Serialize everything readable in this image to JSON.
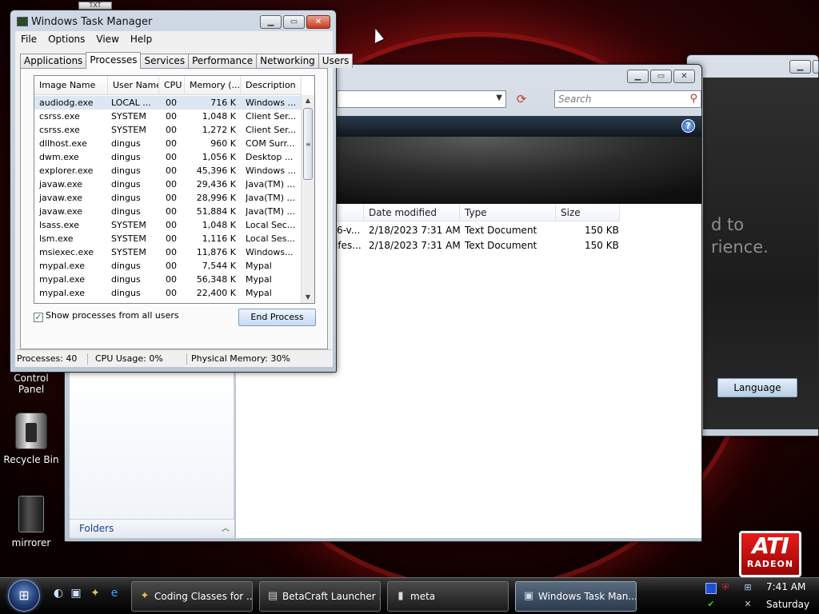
{
  "desktop": {
    "icons": [
      {
        "label": "Control Panel",
        "icon": "control-panel-icon"
      },
      {
        "label": "Recycle Bin",
        "icon": "recycle-bin-icon"
      },
      {
        "label": "mirrorer",
        "icon": "file-icon"
      }
    ],
    "txt_tag": "TXT",
    "ati_logo": {
      "main": "ATI",
      "sub": "RADEON"
    }
  },
  "bg_window": {
    "text_line1": "d to",
    "text_line2": "rience.",
    "language_button": "Language"
  },
  "explorer": {
    "search_placeholder": "Search",
    "columns": [
      "Date modified",
      "Type",
      "Size"
    ],
    "files": [
      {
        "name_fragment": "6-v...",
        "date": "2/18/2023 7:31 AM",
        "type": "Text Document",
        "size": "150 KB"
      },
      {
        "name_fragment": "ifes...",
        "date": "2/18/2023 7:31 AM",
        "type": "Text Document",
        "size": "150 KB"
      }
    ],
    "folders_label": "Folders"
  },
  "taskmgr": {
    "title": "Windows Task Manager",
    "menu": [
      "File",
      "Options",
      "View",
      "Help"
    ],
    "tabs": [
      "Applications",
      "Processes",
      "Services",
      "Performance",
      "Networking",
      "Users"
    ],
    "active_tab": "Processes",
    "columns": [
      "Image Name",
      "User Name",
      "CPU",
      "Memory (...",
      "Description"
    ],
    "processes": [
      {
        "image": "audiodg.exe",
        "user": "LOCAL ...",
        "cpu": "00",
        "mem": "716 K",
        "desc": "Windows ..."
      },
      {
        "image": "csrss.exe",
        "user": "SYSTEM",
        "cpu": "00",
        "mem": "1,048 K",
        "desc": "Client Ser..."
      },
      {
        "image": "csrss.exe",
        "user": "SYSTEM",
        "cpu": "00",
        "mem": "1,272 K",
        "desc": "Client Ser..."
      },
      {
        "image": "dllhost.exe",
        "user": "dingus",
        "cpu": "00",
        "mem": "960 K",
        "desc": "COM Surr..."
      },
      {
        "image": "dwm.exe",
        "user": "dingus",
        "cpu": "00",
        "mem": "1,056 K",
        "desc": "Desktop ..."
      },
      {
        "image": "explorer.exe",
        "user": "dingus",
        "cpu": "00",
        "mem": "45,396 K",
        "desc": "Windows ..."
      },
      {
        "image": "javaw.exe",
        "user": "dingus",
        "cpu": "00",
        "mem": "29,436 K",
        "desc": "Java(TM) ..."
      },
      {
        "image": "javaw.exe",
        "user": "dingus",
        "cpu": "00",
        "mem": "28,996 K",
        "desc": "Java(TM) ..."
      },
      {
        "image": "javaw.exe",
        "user": "dingus",
        "cpu": "00",
        "mem": "51,884 K",
        "desc": "Java(TM) ..."
      },
      {
        "image": "lsass.exe",
        "user": "SYSTEM",
        "cpu": "00",
        "mem": "1,048 K",
        "desc": "Local Sec..."
      },
      {
        "image": "lsm.exe",
        "user": "SYSTEM",
        "cpu": "00",
        "mem": "1,116 K",
        "desc": "Local Ses..."
      },
      {
        "image": "msiexec.exe",
        "user": "SYSTEM",
        "cpu": "00",
        "mem": "11,876 K",
        "desc": "Windows..."
      },
      {
        "image": "mypal.exe",
        "user": "dingus",
        "cpu": "00",
        "mem": "7,544 K",
        "desc": "Mypal"
      },
      {
        "image": "mypal.exe",
        "user": "dingus",
        "cpu": "00",
        "mem": "56,348 K",
        "desc": "Mypal"
      },
      {
        "image": "mypal.exe",
        "user": "dingus",
        "cpu": "00",
        "mem": "22,400 K",
        "desc": "Mypal"
      }
    ],
    "show_all_label": "Show processes from all users",
    "show_all_checked": true,
    "end_process_label": "End Process",
    "status": {
      "processes": "Processes: 40",
      "cpu": "CPU Usage: 0%",
      "memory": "Physical Memory: 30%"
    }
  },
  "taskbar": {
    "buttons": [
      {
        "label": "Coding Classes for ...",
        "icon": "tools-icon"
      },
      {
        "label": "BetaCraft Launcher ...",
        "icon": "launcher-icon"
      },
      {
        "label": "meta",
        "icon": "file-icon"
      },
      {
        "label": "Windows Task Man...",
        "icon": "task-manager-icon",
        "active": true
      }
    ],
    "clock_time": "7:41 AM",
    "clock_day": "Saturday"
  }
}
